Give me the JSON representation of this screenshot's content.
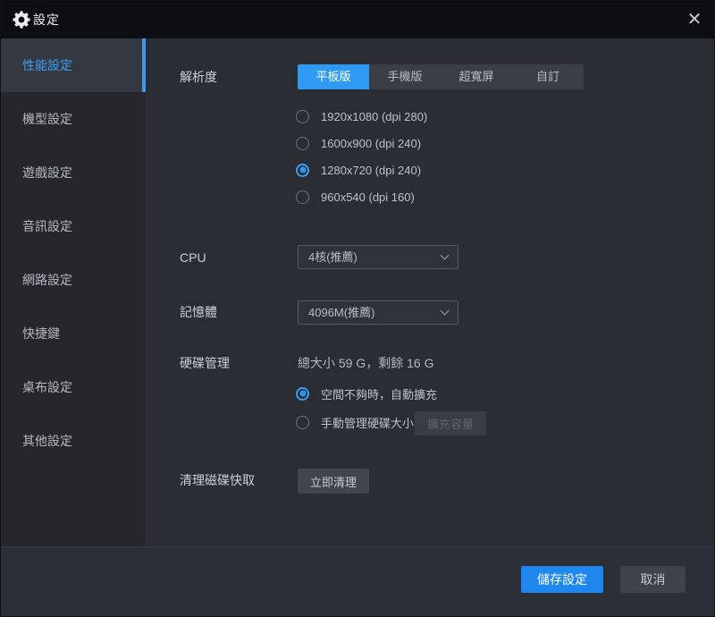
{
  "window": {
    "title": "設定",
    "close_icon": "close-icon"
  },
  "colors": {
    "accent": "#2e9af3",
    "titlebar": "#0d0e11",
    "sidebar": "#25272c",
    "content": "#2a2d33",
    "footer": "#2c2f38"
  },
  "sidebar": {
    "items": [
      {
        "label": "性能設定",
        "active": true
      },
      {
        "label": "機型設定",
        "active": false
      },
      {
        "label": "遊戲設定",
        "active": false
      },
      {
        "label": "音訊設定",
        "active": false
      },
      {
        "label": "網路設定",
        "active": false
      },
      {
        "label": "快捷鍵",
        "active": false
      },
      {
        "label": "桌布設定",
        "active": false
      },
      {
        "label": "其他設定",
        "active": false
      }
    ]
  },
  "main": {
    "resolution": {
      "label": "解析度",
      "tabs": [
        {
          "label": "平板版",
          "active": true
        },
        {
          "label": "手機版",
          "active": false
        },
        {
          "label": "超寬屏",
          "active": false
        },
        {
          "label": "自訂",
          "active": false
        }
      ],
      "options": [
        {
          "label": "1920x1080  (dpi 280)",
          "selected": false
        },
        {
          "label": "1600x900  (dpi 240)",
          "selected": false
        },
        {
          "label": "1280x720  (dpi 240)",
          "selected": true
        },
        {
          "label": "960x540  (dpi 160)",
          "selected": false
        }
      ]
    },
    "cpu": {
      "label": "CPU",
      "value": "4核(推薦)"
    },
    "memory": {
      "label": "記憶體",
      "value": "4096M(推薦)"
    },
    "disk": {
      "label": "硬碟管理",
      "summary": "總大小 59 G，剩餘 16 G",
      "options": [
        {
          "label": "空間不夠時，自動擴充",
          "selected": true
        },
        {
          "label": "手動管理硬碟大小",
          "selected": false
        }
      ],
      "expand_button": "擴充容量"
    },
    "clean": {
      "label": "清理磁碟快取",
      "button": "立即清理"
    }
  },
  "footer": {
    "save": "儲存設定",
    "cancel": "取消"
  }
}
